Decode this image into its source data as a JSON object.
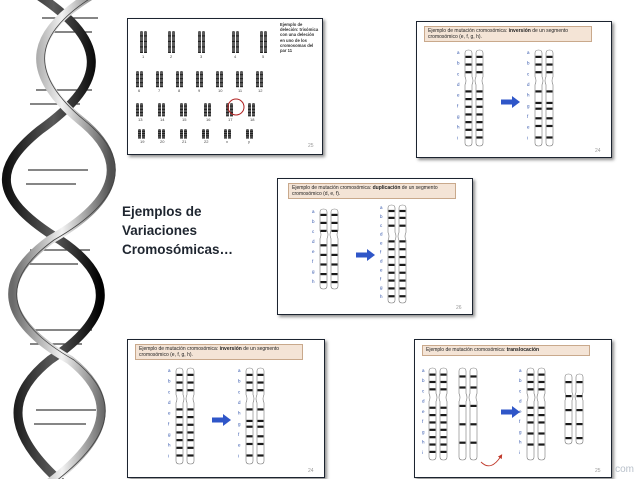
{
  "caption": {
    "line1": "Ejemplos de",
    "line2": "Variaciones",
    "line3": "Cromosómicas…"
  },
  "panels": {
    "karyotype": {
      "note": "Ejemplo de deleción: trisómica con una deleción en uno de los cromosomas del par 11",
      "page": "25",
      "numbers": [
        "1",
        "2",
        "3",
        "4",
        "5",
        "6",
        "7",
        "8",
        "9",
        "10",
        "11",
        "12",
        "13",
        "14",
        "15",
        "16",
        "17",
        "18",
        "19",
        "20",
        "21",
        "22",
        "x",
        "y"
      ]
    },
    "inversion_top": {
      "title_prefix": "Ejemplo de mutación cromosómica: ",
      "title_bold": "inversión",
      "title_suffix": " de un segmento",
      "title_line2": "cromosómico (e, f, g, h).",
      "page": "24"
    },
    "duplication": {
      "title_prefix": "Ejemplo de mutación cromosómica: ",
      "title_bold": "duplicación",
      "title_suffix": " de un segmento",
      "title_line2": "cromosómico (d, e, f).",
      "page": "26"
    },
    "inversion_bottom": {
      "title_prefix": "Ejemplo de mutación cromosómica: ",
      "title_bold": "inversión",
      "title_suffix": " de un segmento",
      "title_line2": "cromosómico (e, f, g, h).",
      "page": "24"
    },
    "translocation": {
      "title_prefix": "Ejemplo de mutación cromosómica: ",
      "title_bold": "translocación",
      "page": "25"
    }
  },
  "watermark": "com",
  "colors": {
    "arrow": "#2f56c8",
    "title_box": "#f4e4d6",
    "title_box_border": "#c9a98c",
    "chromosome_band": "#1a1a1a"
  }
}
